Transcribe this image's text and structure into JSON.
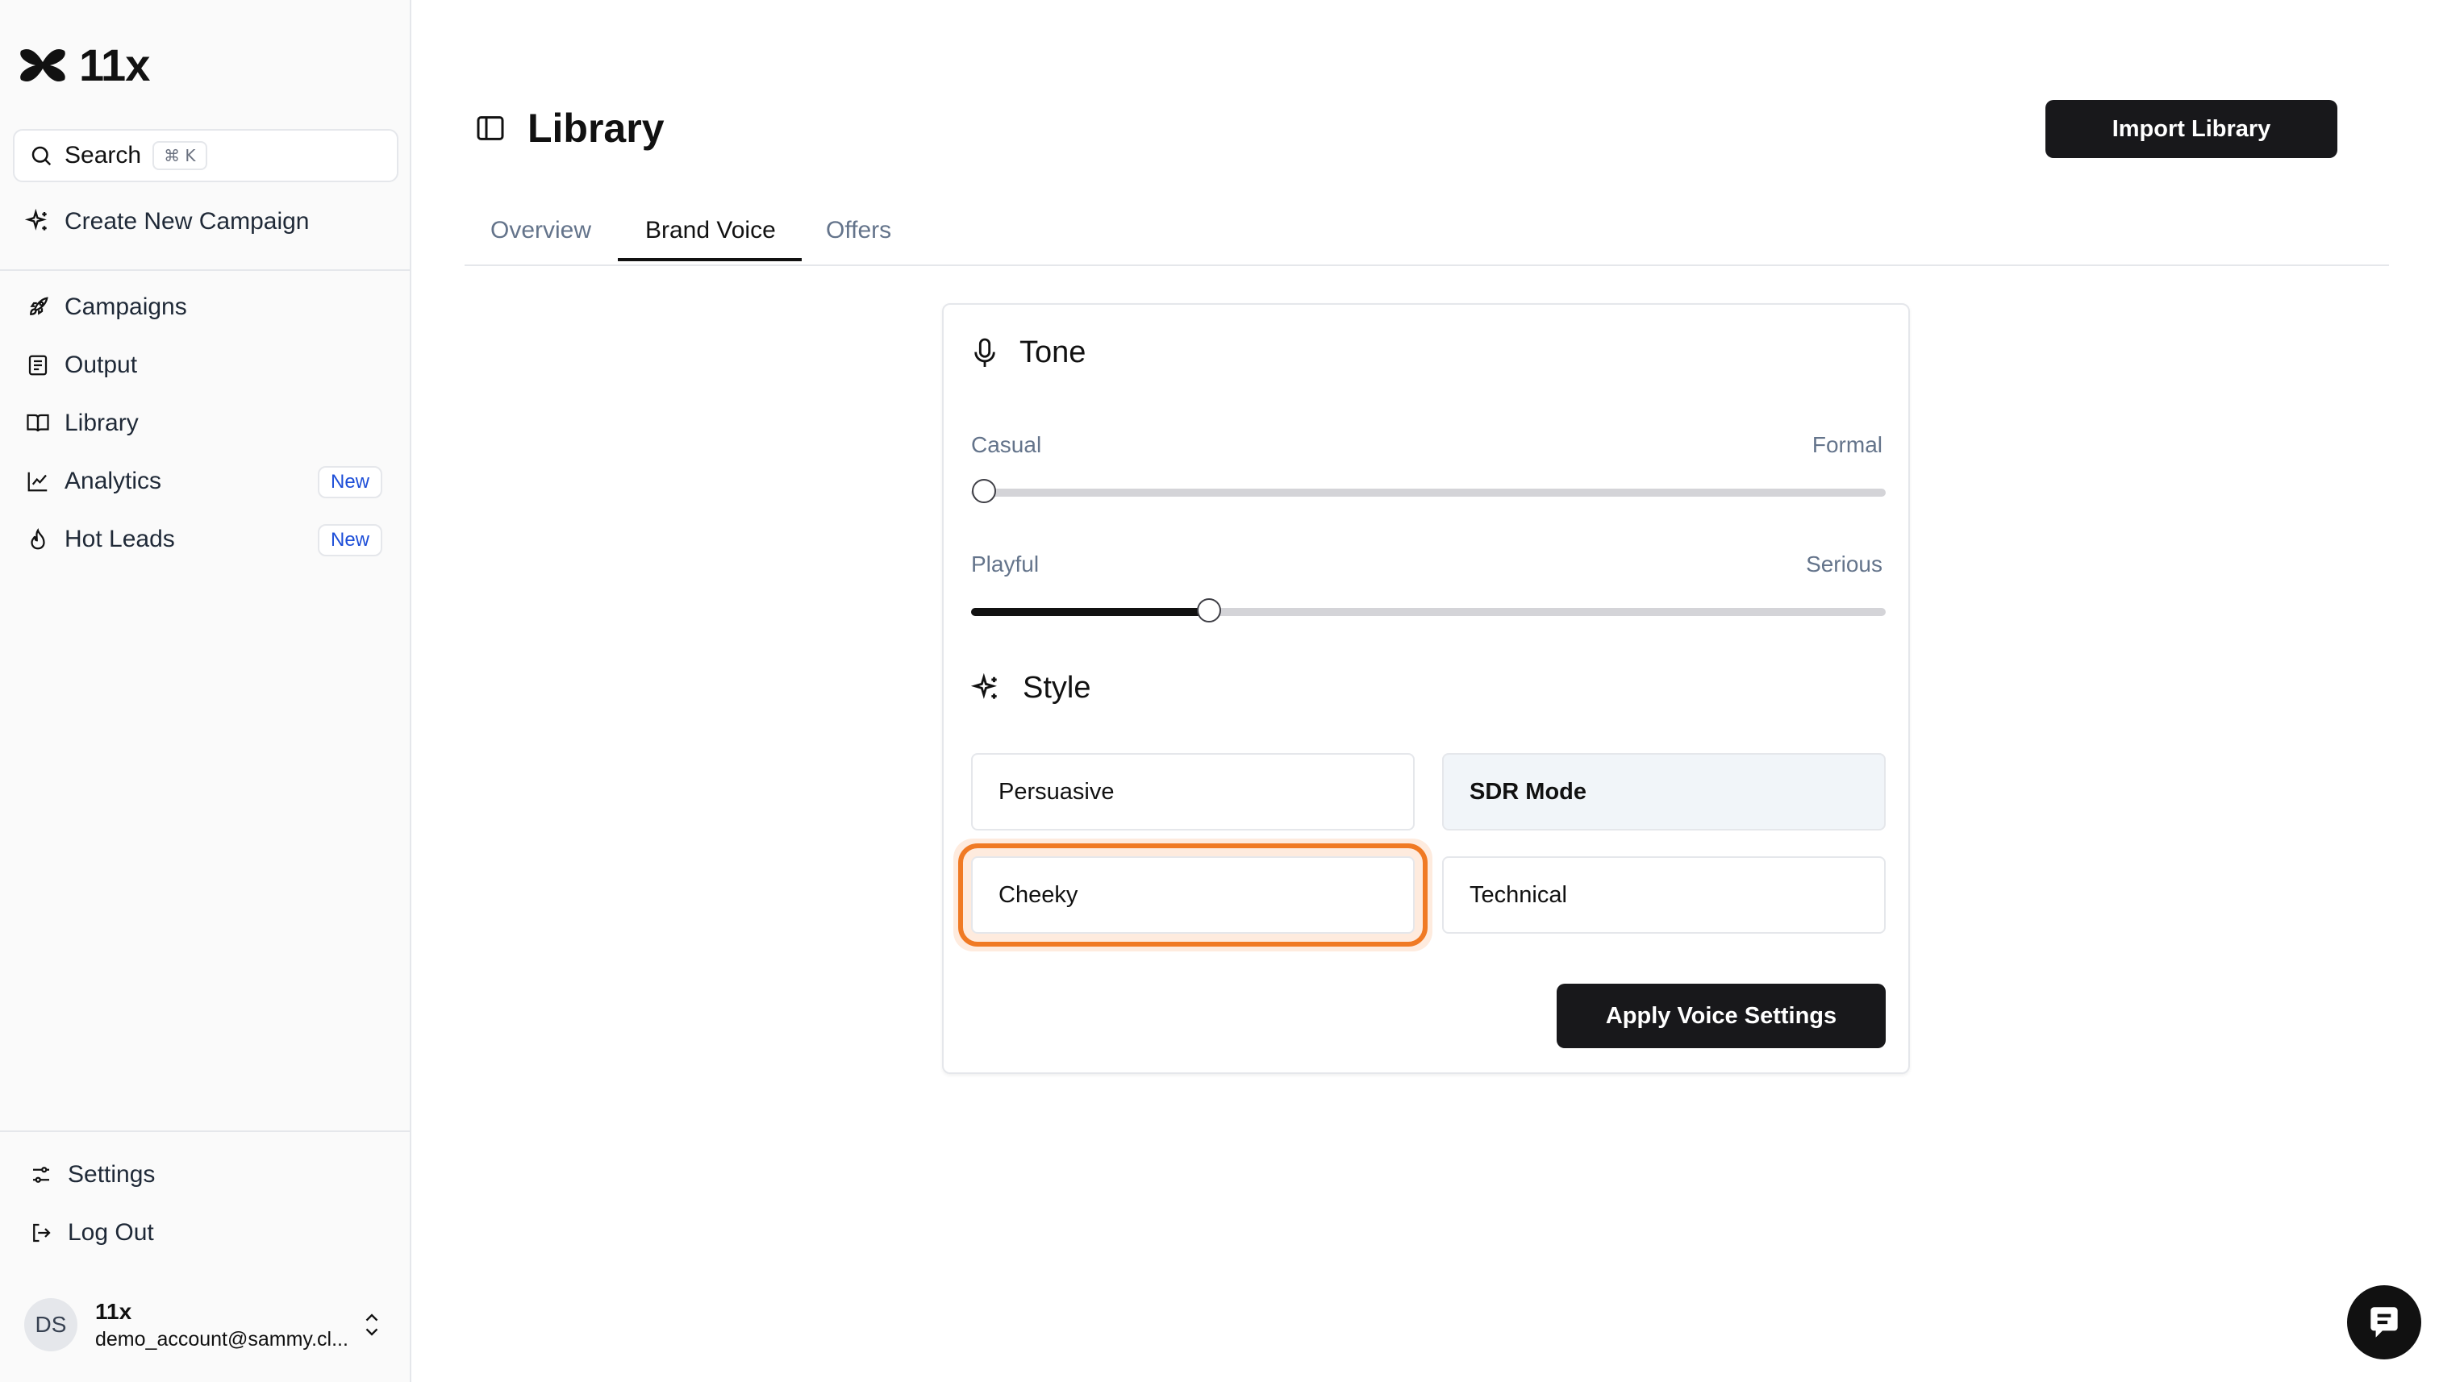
{
  "brand": {
    "name": "11x"
  },
  "sidebar": {
    "search": {
      "label": "Search",
      "shortcut": "⌘ K"
    },
    "create_campaign": "Create New Campaign",
    "items": [
      {
        "label": "Campaigns",
        "icon": "rocket-icon"
      },
      {
        "label": "Output",
        "icon": "document-icon"
      },
      {
        "label": "Library",
        "icon": "book-open-icon"
      },
      {
        "label": "Analytics",
        "icon": "line-chart-icon",
        "badge": "New"
      },
      {
        "label": "Hot Leads",
        "icon": "flame-icon",
        "badge": "New"
      }
    ],
    "settings": "Settings",
    "logout": "Log Out",
    "user": {
      "initials": "DS",
      "name": "11x",
      "email": "demo_account@sammy.cl..."
    }
  },
  "header": {
    "title": "Library",
    "import_button": "Import Library"
  },
  "tabs": [
    {
      "label": "Overview",
      "active": false
    },
    {
      "label": "Brand Voice",
      "active": true
    },
    {
      "label": "Offers",
      "active": false
    }
  ],
  "brand_voice": {
    "tone": {
      "heading": "Tone",
      "sliders": [
        {
          "left": "Casual",
          "right": "Formal",
          "value": 0.0
        },
        {
          "left": "Playful",
          "right": "Serious",
          "value": 0.26
        }
      ]
    },
    "style": {
      "heading": "Style",
      "options": [
        {
          "label": "Persuasive",
          "selected": false
        },
        {
          "label": "SDR Mode",
          "selected": true
        },
        {
          "label": "Cheeky",
          "selected": false,
          "focused": true
        },
        {
          "label": "Technical",
          "selected": false
        }
      ]
    },
    "apply_button": "Apply Voice Settings"
  },
  "colors": {
    "accent_focus": "#f07a24",
    "primary_button": "#18181b",
    "badge_text": "#1d4ed8"
  }
}
